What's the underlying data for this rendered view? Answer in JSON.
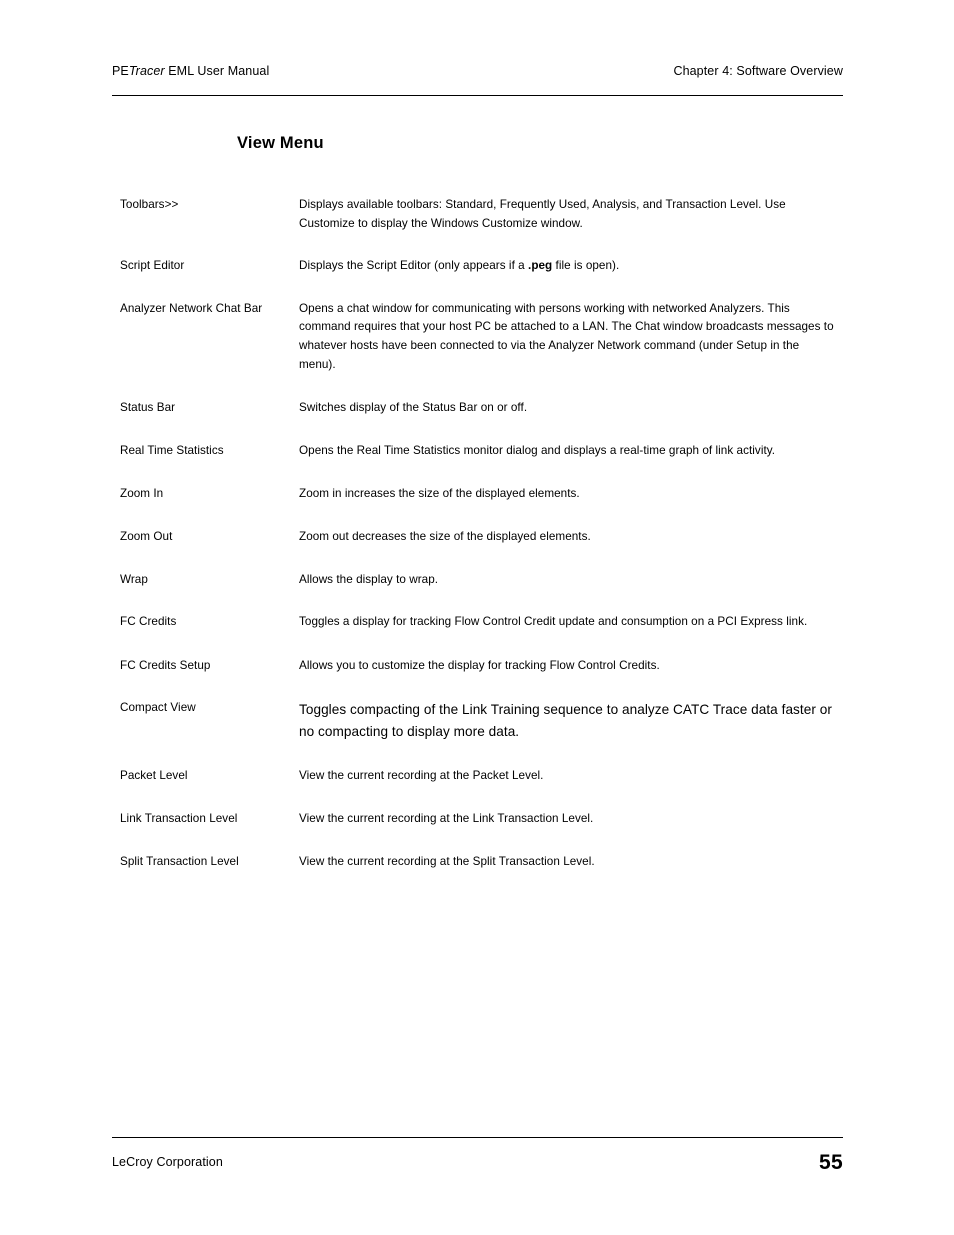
{
  "header": {
    "left_prefix": "PE",
    "left_italic": "Tracer",
    "left_suffix": " EML User Manual",
    "right": "Chapter 4: Software Overview"
  },
  "section": {
    "title": "View Menu"
  },
  "menu_items": [
    {
      "term": "Toolbars>>",
      "desc_pre": "Displays available toolbars: Standard, Frequently Used, Analysis, and Transaction Level. Use Customize to  display the Windows Customize window.",
      "desc_bold": "",
      "desc_post": "",
      "large": false
    },
    {
      "term": "Script Editor",
      "desc_pre": "Displays the Script Editor (only appears if a ",
      "desc_bold": ".peg",
      "desc_post": " file is open).",
      "large": false
    },
    {
      "term": "Analyzer Network Chat Bar",
      "desc_pre": "Opens a chat window for communicating with persons working with networked Analyzers. This command requires that your host PC be attached to a LAN. The Chat window broadcasts messages to whatever hosts have been connected to via the Analyzer Network command (under Setup in the menu).",
      "desc_bold": "",
      "desc_post": "",
      "large": false
    },
    {
      "term": "Status Bar",
      "desc_pre": "Switches display of the Status Bar on or off.",
      "desc_bold": "",
      "desc_post": "",
      "large": false
    },
    {
      "term": "Real Time Statistics",
      "desc_pre": "Opens the Real Time Statistics monitor dialog and displays a real-time graph of link activity.",
      "desc_bold": "",
      "desc_post": "",
      "large": false
    },
    {
      "term": "Zoom In",
      "desc_pre": "Zoom in increases the size of the displayed elements.",
      "desc_bold": "",
      "desc_post": "",
      "large": false
    },
    {
      "term": "Zoom Out",
      "desc_pre": "Zoom out decreases the size of the displayed elements.",
      "desc_bold": "",
      "desc_post": "",
      "large": false
    },
    {
      "term": "Wrap",
      "desc_pre": "Allows the display to wrap.",
      "desc_bold": "",
      "desc_post": "",
      "large": false
    },
    {
      "term": "FC Credits",
      "desc_pre": "Toggles a display for tracking Flow Control Credit update and consumption on a PCI Express link.",
      "desc_bold": "",
      "desc_post": "",
      "large": false
    },
    {
      "term": "FC Credits Setup",
      "desc_pre": "Allows you to customize the display for tracking Flow Control Credits.",
      "desc_bold": "",
      "desc_post": "",
      "large": false
    },
    {
      "term": "Compact View",
      "desc_pre": "Toggles compacting of the Link Training sequence to analyze CATC Trace data faster or no compacting to display more data.",
      "desc_bold": "",
      "desc_post": "",
      "large": true
    },
    {
      "term": "Packet Level",
      "desc_pre": "View the current recording at the Packet Level.",
      "desc_bold": "",
      "desc_post": "",
      "large": false
    },
    {
      "term": "Link Transaction Level",
      "desc_pre": "View the current recording at the Link Transaction Level.",
      "desc_bold": "",
      "desc_post": "",
      "large": false
    },
    {
      "term": "Split Transaction Level",
      "desc_pre": "View the current recording at the Split Transaction Level.",
      "desc_bold": "",
      "desc_post": "",
      "large": false
    }
  ],
  "footer": {
    "left": "LeCroy Corporation",
    "page_number": "55"
  }
}
